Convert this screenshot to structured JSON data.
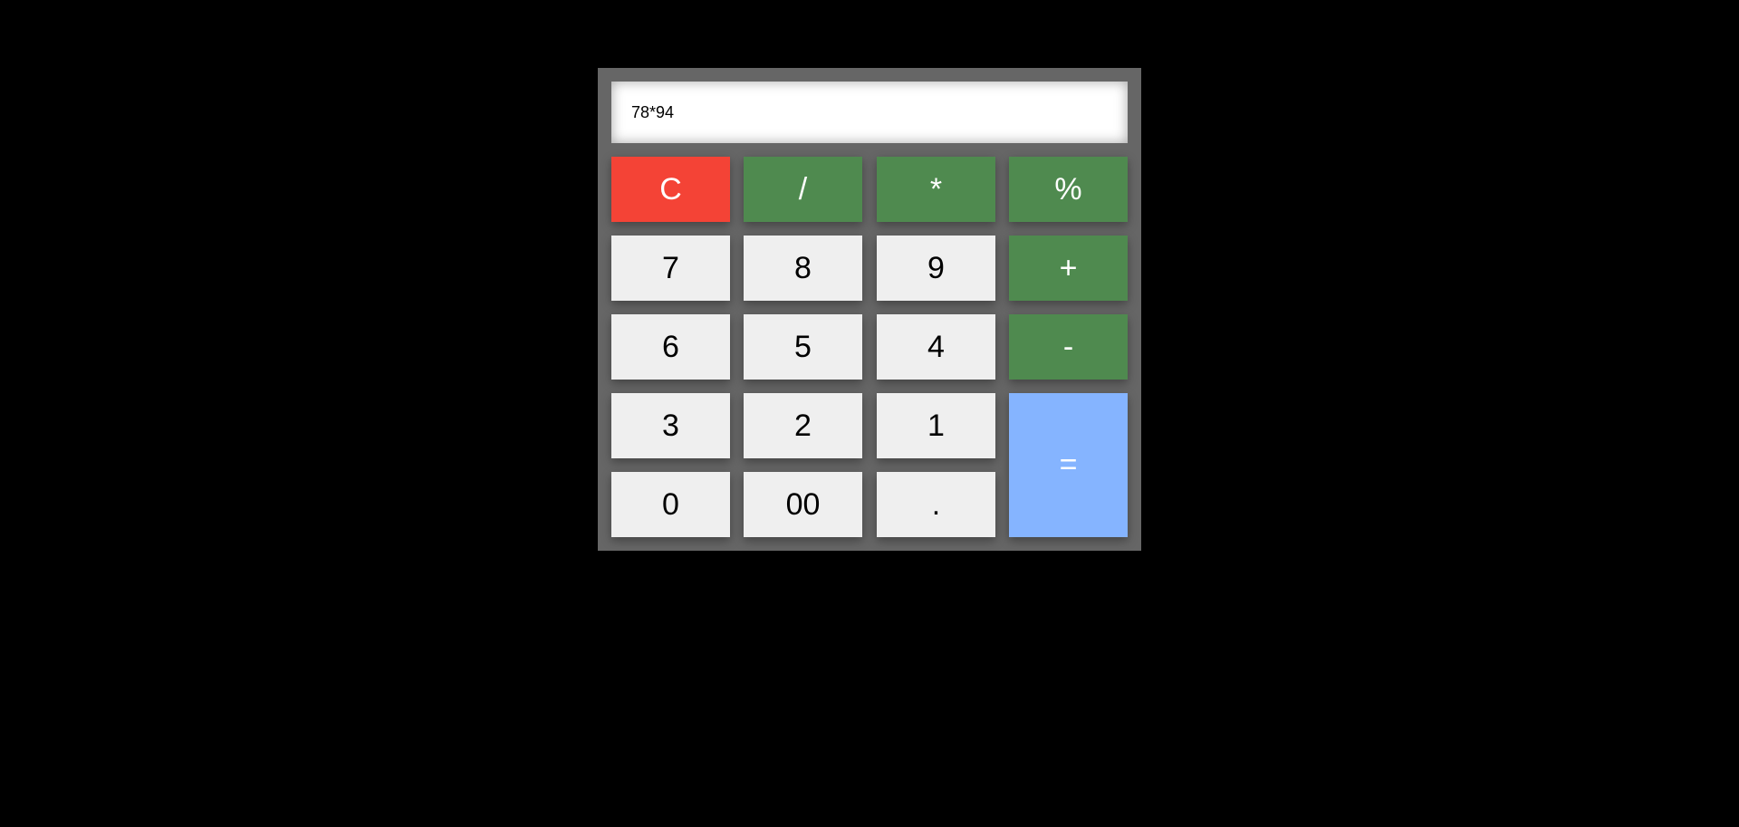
{
  "display": {
    "value": "78*94"
  },
  "buttons": {
    "clear": "C",
    "divide": "/",
    "multiply": "*",
    "percent": "%",
    "seven": "7",
    "eight": "8",
    "nine": "9",
    "plus": "+",
    "six": "6",
    "five": "5",
    "four": "4",
    "minus": "-",
    "three": "3",
    "two": "2",
    "one": "1",
    "equals": "=",
    "zero": "0",
    "double_zero": "00",
    "decimal": "."
  },
  "colors": {
    "background": "#000000",
    "calculator_body": "#666666",
    "clear": "#f44336",
    "operator": "#4f8a4f",
    "number": "#efefef",
    "equals": "#85b4ff"
  }
}
